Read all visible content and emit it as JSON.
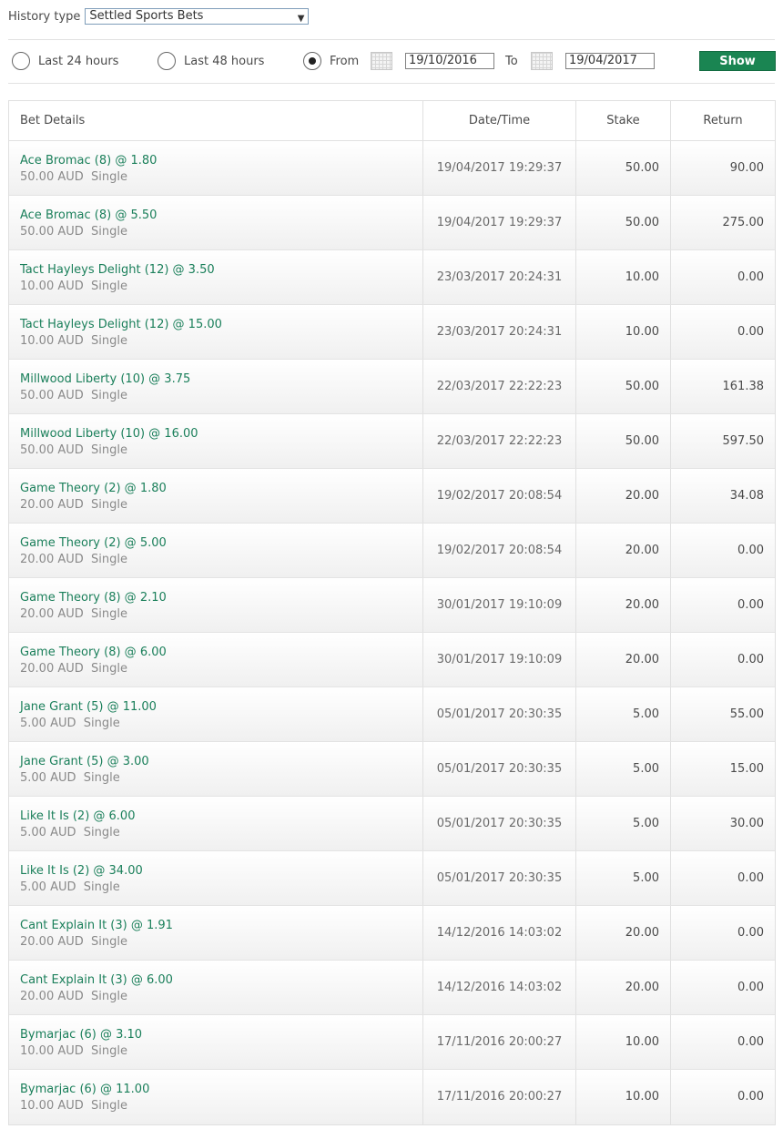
{
  "history": {
    "label": "History type",
    "selected": "Settled Sports Bets"
  },
  "filters": {
    "last24": "Last 24 hours",
    "last48": "Last 48 hours",
    "from_label": "From",
    "from_date": "19/10/2016",
    "to_label": "To",
    "to_date": "19/04/2017",
    "selected": "from",
    "show_label": "Show"
  },
  "table": {
    "headers": [
      "Bet Details",
      "Date/Time",
      "Stake",
      "Return"
    ],
    "rows": [
      {
        "selection": "Ace Bromac (8) @ 1.80",
        "sub": "50.00 AUD  Single",
        "datetime": "19/04/2017 19:29:37",
        "stake": "50.00",
        "return": "90.00"
      },
      {
        "selection": "Ace Bromac (8) @ 5.50",
        "sub": "50.00 AUD  Single",
        "datetime": "19/04/2017 19:29:37",
        "stake": "50.00",
        "return": "275.00"
      },
      {
        "selection": "Tact Hayleys Delight (12) @ 3.50",
        "sub": "10.00 AUD  Single",
        "datetime": "23/03/2017 20:24:31",
        "stake": "10.00",
        "return": "0.00"
      },
      {
        "selection": "Tact Hayleys Delight (12) @ 15.00",
        "sub": "10.00 AUD  Single",
        "datetime": "23/03/2017 20:24:31",
        "stake": "10.00",
        "return": "0.00"
      },
      {
        "selection": "Millwood Liberty (10) @ 3.75",
        "sub": "50.00 AUD  Single",
        "datetime": "22/03/2017 22:22:23",
        "stake": "50.00",
        "return": "161.38"
      },
      {
        "selection": "Millwood Liberty (10) @ 16.00",
        "sub": "50.00 AUD  Single",
        "datetime": "22/03/2017 22:22:23",
        "stake": "50.00",
        "return": "597.50"
      },
      {
        "selection": "Game Theory (2) @ 1.80",
        "sub": "20.00 AUD  Single",
        "datetime": "19/02/2017 20:08:54",
        "stake": "20.00",
        "return": "34.08"
      },
      {
        "selection": "Game Theory (2) @ 5.00",
        "sub": "20.00 AUD  Single",
        "datetime": "19/02/2017 20:08:54",
        "stake": "20.00",
        "return": "0.00"
      },
      {
        "selection": "Game Theory (8) @ 2.10",
        "sub": "20.00 AUD  Single",
        "datetime": "30/01/2017 19:10:09",
        "stake": "20.00",
        "return": "0.00"
      },
      {
        "selection": "Game Theory (8) @ 6.00",
        "sub": "20.00 AUD  Single",
        "datetime": "30/01/2017 19:10:09",
        "stake": "20.00",
        "return": "0.00"
      },
      {
        "selection": "Jane Grant (5) @ 11.00",
        "sub": "5.00 AUD  Single",
        "datetime": "05/01/2017 20:30:35",
        "stake": "5.00",
        "return": "55.00"
      },
      {
        "selection": "Jane Grant (5) @ 3.00",
        "sub": "5.00 AUD  Single",
        "datetime": "05/01/2017 20:30:35",
        "stake": "5.00",
        "return": "15.00"
      },
      {
        "selection": "Like It Is (2) @ 6.00",
        "sub": "5.00 AUD  Single",
        "datetime": "05/01/2017 20:30:35",
        "stake": "5.00",
        "return": "30.00"
      },
      {
        "selection": "Like It Is (2) @ 34.00",
        "sub": "5.00 AUD  Single",
        "datetime": "05/01/2017 20:30:35",
        "stake": "5.00",
        "return": "0.00"
      },
      {
        "selection": "Cant Explain It (3) @ 1.91",
        "sub": "20.00 AUD  Single",
        "datetime": "14/12/2016 14:03:02",
        "stake": "20.00",
        "return": "0.00"
      },
      {
        "selection": "Cant Explain It (3) @ 6.00",
        "sub": "20.00 AUD  Single",
        "datetime": "14/12/2016 14:03:02",
        "stake": "20.00",
        "return": "0.00"
      },
      {
        "selection": "Bymarjac (6) @ 3.10",
        "sub": "10.00 AUD  Single",
        "datetime": "17/11/2016 20:00:27",
        "stake": "10.00",
        "return": "0.00"
      },
      {
        "selection": "Bymarjac (6) @ 11.00",
        "sub": "10.00 AUD  Single",
        "datetime": "17/11/2016 20:00:27",
        "stake": "10.00",
        "return": "0.00"
      }
    ]
  },
  "colors": {
    "accent": "#1a7f5a",
    "button": "#1a8552"
  }
}
